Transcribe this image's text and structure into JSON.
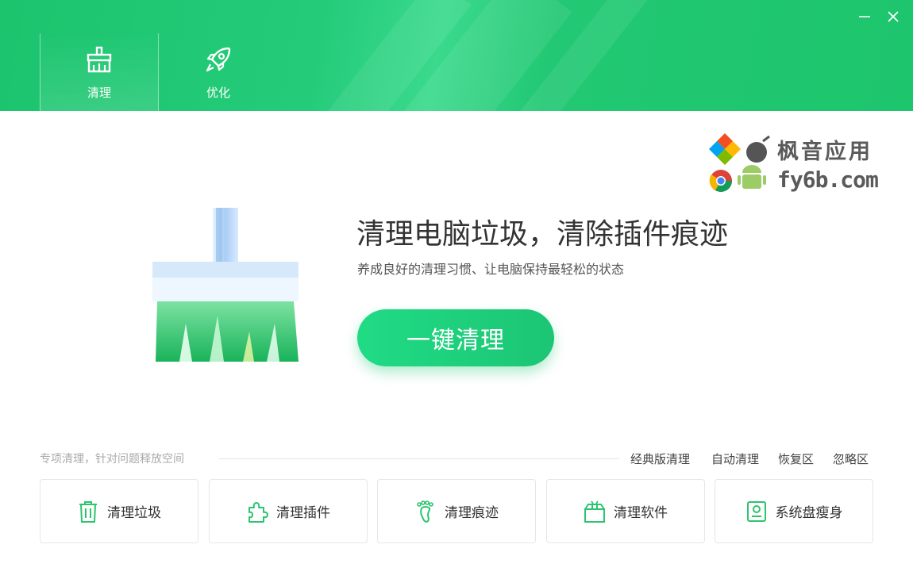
{
  "header": {
    "tabs": [
      {
        "label": "清理",
        "icon": "broom-icon",
        "active": true
      },
      {
        "label": "优化",
        "icon": "rocket-icon",
        "active": false
      }
    ],
    "window_controls": {
      "minimize": "minimize-icon",
      "close": "close-icon"
    },
    "accent": "#1dc56d"
  },
  "watermark": {
    "line1": "枫音应用",
    "line2": "fy6b.com"
  },
  "hero": {
    "title": "清理电脑垃圾，清除插件痕迹",
    "subtitle": "养成良好的清理习惯、让电脑保持最轻松的状态",
    "button_label": "一键清理"
  },
  "special": {
    "label": "专项清理，针对问题释放空间",
    "links": [
      "经典版清理",
      "自动清理",
      "恢复区",
      "忽略区"
    ],
    "cards": [
      {
        "label": "清理垃圾",
        "icon": "trash-icon"
      },
      {
        "label": "清理插件",
        "icon": "puzzle-icon"
      },
      {
        "label": "清理痕迹",
        "icon": "footprint-icon"
      },
      {
        "label": "清理软件",
        "icon": "software-box-icon"
      },
      {
        "label": "系统盘瘦身",
        "icon": "disk-icon"
      }
    ]
  }
}
